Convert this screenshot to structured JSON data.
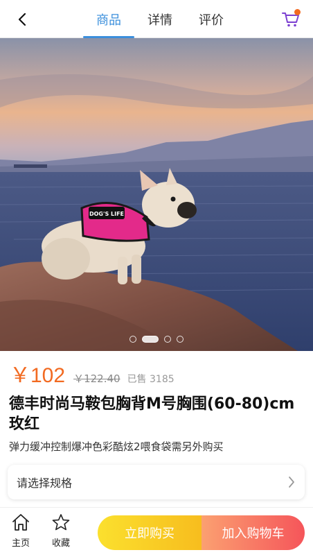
{
  "header": {
    "back_icon": "chevron-left-icon",
    "tabs": [
      {
        "label": "商品",
        "active": true
      },
      {
        "label": "详情",
        "active": false
      },
      {
        "label": "评价",
        "active": false
      }
    ],
    "cart_icon": "cart-icon",
    "accent_color": "#3b8fdc",
    "badge_color": "#f26a21"
  },
  "gallery": {
    "image_alt": "dog on rock by the sea",
    "harness_text": "DOG'S LIFE",
    "slide_count": 4,
    "active_slide": 2
  },
  "product": {
    "price": "￥102",
    "original_price": "￥122.40",
    "sold": "已售 3185",
    "title": "德丰时尚马鞍包胸背M号胸围(60-80)cm玫红",
    "subtitle": "弹力缓冲控制爆冲色彩酷炫2喂食袋需另外购买",
    "price_color": "#f26a21"
  },
  "spec": {
    "label": "请选择规格",
    "arrow_icon": "chevron-right-icon"
  },
  "bottom": {
    "home_label": "主页",
    "home_icon": "home-icon",
    "fav_label": "收藏",
    "fav_icon": "star-icon",
    "buy_now": "立即购买",
    "add_to_cart": "加入购物车"
  }
}
